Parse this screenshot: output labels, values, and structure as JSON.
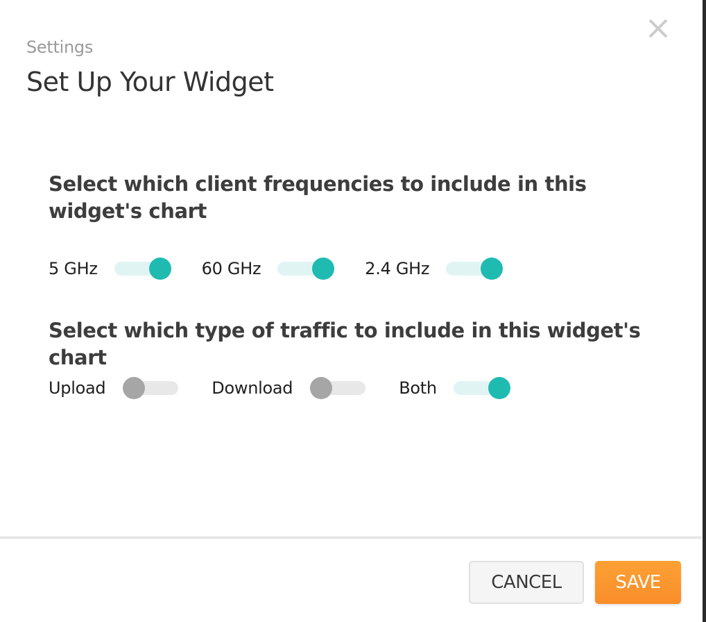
{
  "dialog": {
    "eyebrow": "Settings",
    "title": "Set Up Your Widget",
    "close_icon": "close-icon"
  },
  "frequencies": {
    "heading": "Select which client frequencies to include in this widget's chart",
    "options": [
      {
        "label": "5 GHz",
        "enabled": true
      },
      {
        "label": "60 GHz",
        "enabled": true
      },
      {
        "label": "2.4 GHz",
        "enabled": true
      }
    ]
  },
  "traffic": {
    "heading": "Select which type of traffic to include in this widget's chart",
    "options": [
      {
        "label": "Upload",
        "enabled": false
      },
      {
        "label": "Download",
        "enabled": false
      },
      {
        "label": "Both",
        "enabled": true
      }
    ]
  },
  "footer": {
    "cancel_label": "CANCEL",
    "save_label": "SAVE"
  },
  "colors": {
    "toggle_on_knob": "#1fbbb1",
    "toggle_on_track": "#e0f5f3",
    "toggle_off_knob": "#a6a6a6",
    "toggle_off_track": "#e8e8e8",
    "save_button": "#fb9a30"
  }
}
